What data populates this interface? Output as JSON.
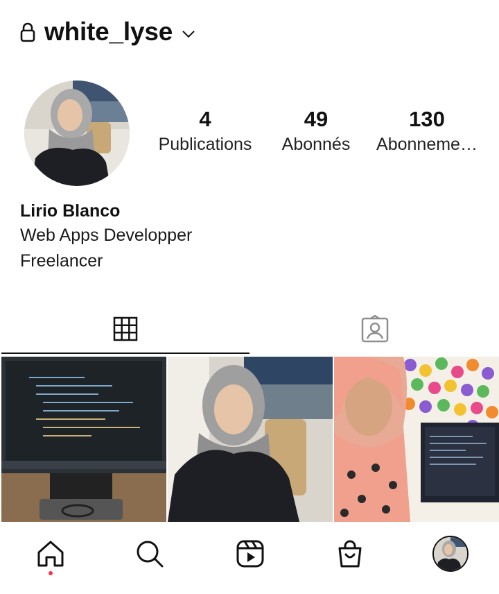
{
  "header": {
    "username": "white_lyse",
    "icons": {
      "lock": "lock-icon",
      "dropdown": "chevron-down-icon"
    }
  },
  "profile": {
    "avatar_icon": "profile-photo"
  },
  "stats": {
    "posts": {
      "count": "4",
      "label": "Publications"
    },
    "followers": {
      "count": "49",
      "label": "Abonnés"
    },
    "following": {
      "count": "130",
      "label": "Abonneme…"
    }
  },
  "bio": {
    "name": "Lirio Blanco",
    "lines": [
      "Web Apps Developper",
      "Freelancer"
    ]
  },
  "tabs": [
    {
      "icon": "grid-icon",
      "selected": true
    },
    {
      "icon": "tagged-icon",
      "selected": false
    }
  ],
  "posts": [
    {
      "subject": "computer-monitor-with-code"
    },
    {
      "subject": "woman-in-hijab-seaside"
    },
    {
      "subject": "woman-selfie-colorful-dots"
    }
  ],
  "bottom_nav": [
    {
      "icon": "home-icon",
      "active": true,
      "notification_dot": true
    },
    {
      "icon": "search-icon"
    },
    {
      "icon": "reels-icon"
    },
    {
      "icon": "shop-icon"
    },
    {
      "icon": "profile-avatar"
    }
  ],
  "colors": {
    "text": "#111111",
    "notification": "#ff3040",
    "tab_inactive": "#8e8e8e"
  }
}
